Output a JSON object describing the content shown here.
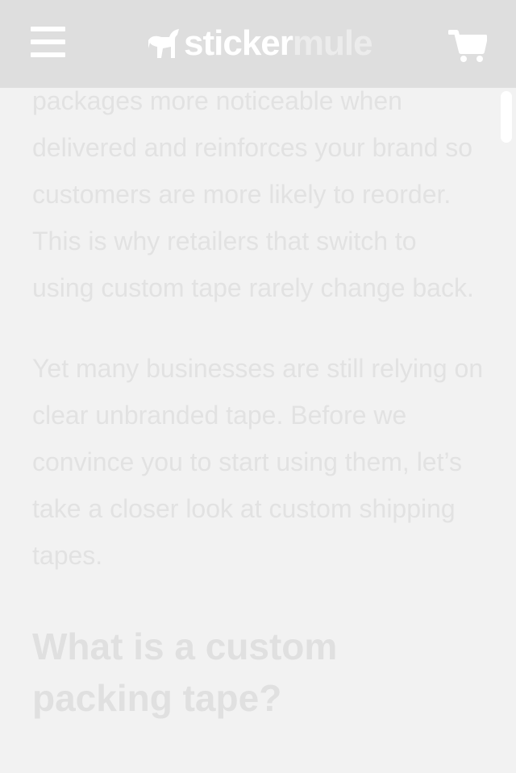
{
  "header": {
    "logo_part1": "sticker",
    "logo_part2": "mule",
    "menu_icon": "hamburger-menu-icon",
    "cart_icon": "shopping-cart-icon"
  },
  "article": {
    "paragraph1": "packages more noticeable when delivered and reinforces your brand so customers are more likely to reorder. This is why retailers that switch to using custom tape rarely change back.",
    "paragraph2": "Yet many businesses are still relying on clear unbranded tape. Before we convince you to start using them, let’s take a closer look at custom shipping tapes.",
    "heading": "What is a custom packing tape?"
  },
  "colors": {
    "header_bg": "#dedede",
    "page_bg": "#f2f2f2",
    "text": "#e2e2e2"
  }
}
